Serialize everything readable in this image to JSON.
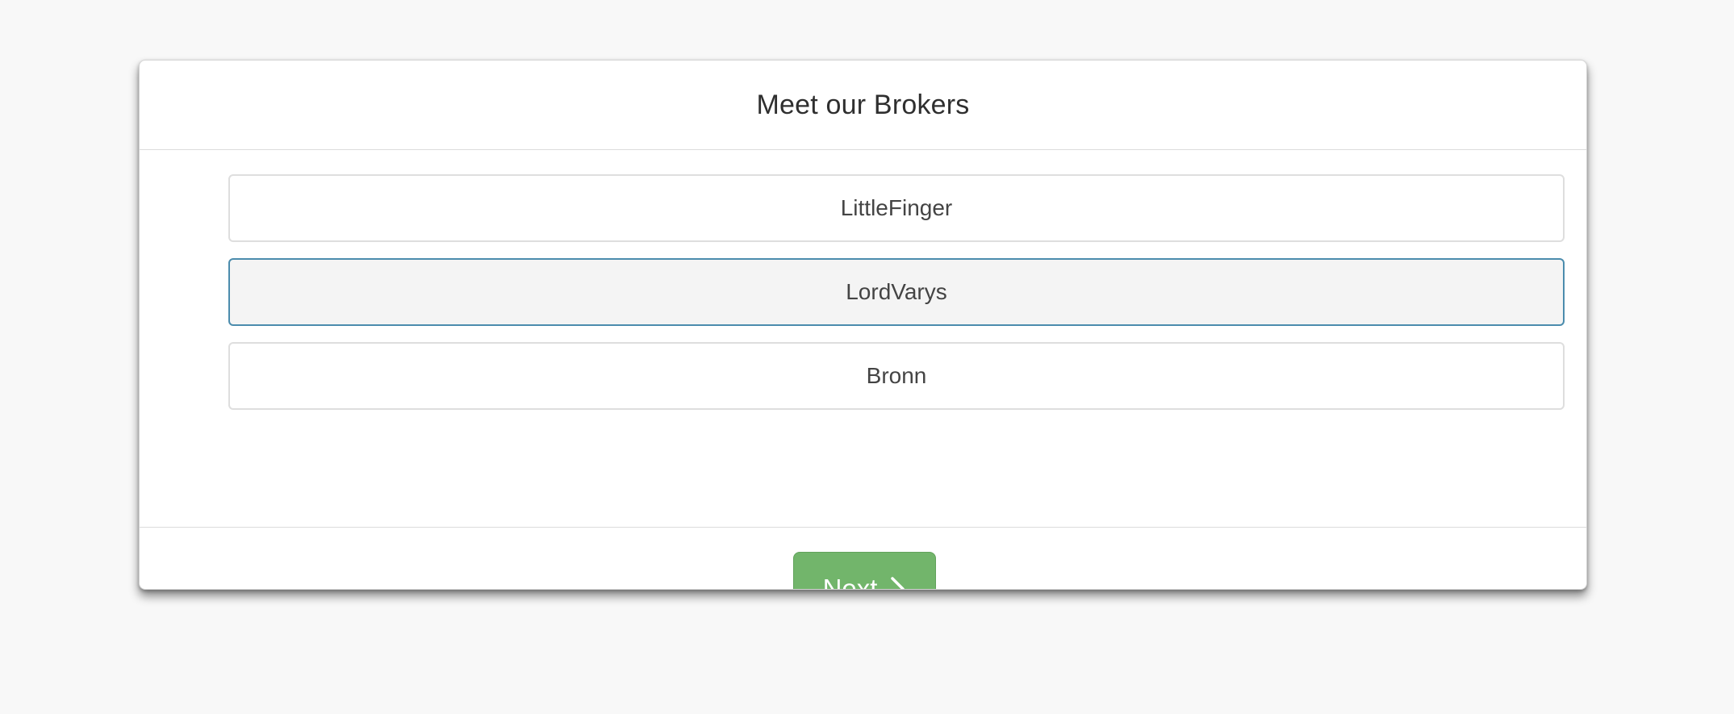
{
  "panel": {
    "title": "Meet our Brokers"
  },
  "brokers": [
    {
      "label": "LittleFinger",
      "selected": false
    },
    {
      "label": "LordVarys",
      "selected": true
    },
    {
      "label": "Bronn",
      "selected": false
    }
  ],
  "footer": {
    "next_label": "Next",
    "next_icon": "chevron-right-icon"
  },
  "colors": {
    "background": "#f8f8f8",
    "next_button": "#72b56b",
    "selected_border": "#4b8cad",
    "selected_background": "#f4f4f4"
  }
}
